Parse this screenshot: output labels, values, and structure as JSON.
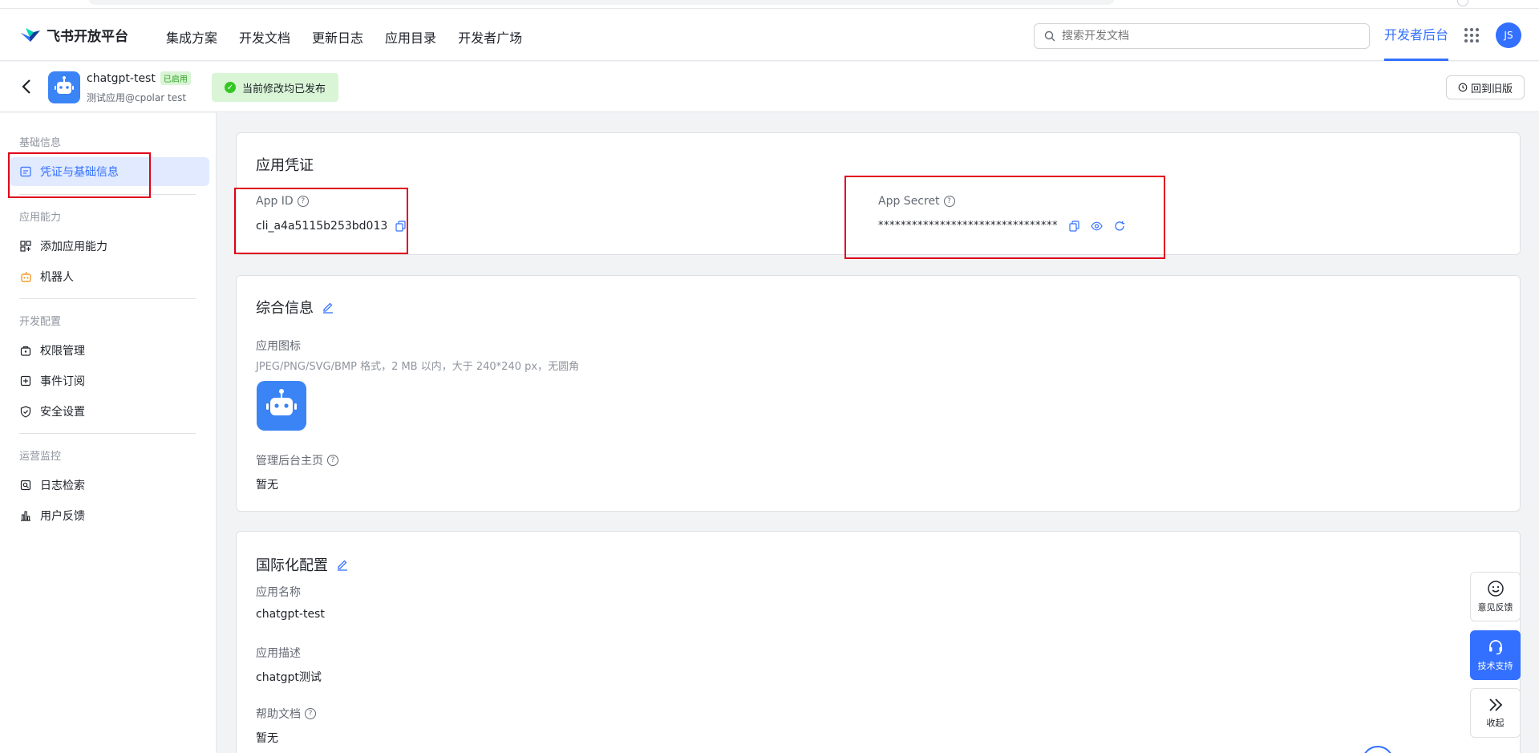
{
  "nav": {
    "brand": "飞书开放平台",
    "links": [
      "集成方案",
      "开发文档",
      "更新日志",
      "应用目录",
      "开发者广场"
    ],
    "search_placeholder": "搜索开发文档",
    "dev_console": "开发者后台",
    "avatar_initials": "JS"
  },
  "app": {
    "name": "chatgpt-test",
    "status_badge": "已启用",
    "subtitle": "测试应用@cpolar test",
    "publish_note": "当前修改均已发布",
    "old_version_label": "回到旧版"
  },
  "sidebar": {
    "groups": [
      {
        "label": "基础信息"
      },
      {
        "label": "应用能力"
      },
      {
        "label": "开发配置"
      },
      {
        "label": "运营监控"
      }
    ],
    "items": [
      {
        "label": "凭证与基础信息",
        "icon": "credential-icon",
        "active": true
      },
      {
        "label": "添加应用能力",
        "icon": "apps-grid-icon"
      },
      {
        "label": "机器人",
        "icon": "robot-icon"
      },
      {
        "label": "权限管理",
        "icon": "permission-icon"
      },
      {
        "label": "事件订阅",
        "icon": "event-icon"
      },
      {
        "label": "安全设置",
        "icon": "shield-icon"
      },
      {
        "label": "日志检索",
        "icon": "log-search-icon"
      },
      {
        "label": "用户反馈",
        "icon": "feedback-chart-icon"
      }
    ]
  },
  "credentials": {
    "title": "应用凭证",
    "app_id_label": "App ID",
    "app_id_value": "cli_a4a5115b253bd013",
    "app_secret_label": "App Secret",
    "app_secret_value": "********************************"
  },
  "general": {
    "title": "综合信息",
    "icon_label": "应用图标",
    "icon_hint": "JPEG/PNG/SVG/BMP 格式，2 MB 以内，大于 240*240 px，无圆角",
    "admin_home_label": "管理后台主页",
    "admin_home_value": "暂无"
  },
  "i18n": {
    "title": "国际化配置",
    "name_label": "应用名称",
    "name_value": "chatgpt-test",
    "desc_label": "应用描述",
    "desc_value": "chatgpt测试",
    "help_doc_label": "帮助文档",
    "help_doc_value": "暂无"
  },
  "float": {
    "feedback": "意见反馈",
    "support": "技术支持",
    "collapse": "收起"
  },
  "colors": {
    "accent": "#3370ff",
    "success_bg": "#d9f5d6",
    "highlight_box": "#e0001a"
  }
}
